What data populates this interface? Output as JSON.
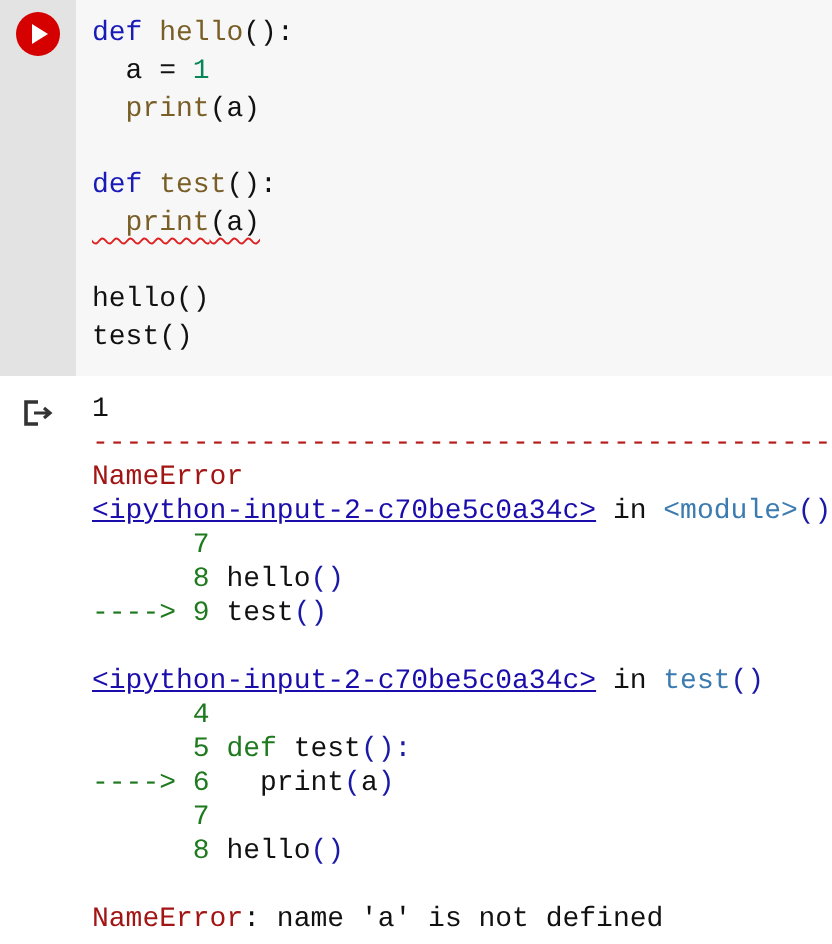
{
  "code_cell": {
    "blocks": [
      [
        {
          "tokens": [
            {
              "text": "def",
              "kind": "kw"
            },
            {
              "text": " hello",
              "kind": "fn"
            },
            {
              "text": "():",
              "kind": "plain"
            }
          ]
        },
        {
          "tokens": [
            {
              "text": "  a = ",
              "kind": "plain"
            },
            {
              "text": "1",
              "kind": "num"
            }
          ]
        },
        {
          "tokens": [
            {
              "text": "  print",
              "kind": "fn"
            },
            {
              "text": "(a)",
              "kind": "plain"
            }
          ]
        }
      ],
      [
        {
          "tokens": [
            {
              "text": "def",
              "kind": "kw"
            },
            {
              "text": " test",
              "kind": "fn"
            },
            {
              "text": "():",
              "kind": "plain"
            }
          ]
        },
        {
          "tokens": [
            {
              "text": "  print",
              "kind": "fn"
            },
            {
              "text": "(a)",
              "kind": "plain"
            }
          ],
          "error": true
        }
      ],
      [
        {
          "tokens": [
            {
              "text": "hello()",
              "kind": "plain"
            }
          ]
        },
        {
          "tokens": [
            {
              "text": "test()",
              "kind": "plain"
            }
          ]
        }
      ]
    ]
  },
  "output": {
    "blocks": [
      [
        {
          "tokens": [
            {
              "text": "1",
              "kind": "plain"
            }
          ]
        },
        {
          "tokens": [
            {
              "text": "--------------------------------------------",
              "kind": "rule"
            }
          ]
        },
        {
          "tokens": [
            {
              "text": "NameError",
              "kind": "err"
            }
          ]
        },
        {
          "tokens": [
            {
              "text": "<ipython-input-2-c70be5c0a34c>",
              "kind": "link"
            },
            {
              "text": " in ",
              "kind": "plain"
            },
            {
              "text": "<module>",
              "kind": "func"
            },
            {
              "text": "()",
              "kind": "paren"
            }
          ]
        },
        {
          "tokens": [
            {
              "text": "      7",
              "kind": "lineno"
            }
          ]
        },
        {
          "tokens": [
            {
              "text": "      8",
              "kind": "lineno"
            },
            {
              "text": " hello",
              "kind": "plain"
            },
            {
              "text": "()",
              "kind": "paren"
            }
          ]
        },
        {
          "tokens": [
            {
              "text": "----> 9",
              "kind": "lineno"
            },
            {
              "text": " test",
              "kind": "plain"
            },
            {
              "text": "()",
              "kind": "paren"
            }
          ]
        }
      ],
      [
        {
          "tokens": [
            {
              "text": "<ipython-input-2-c70be5c0a34c>",
              "kind": "link"
            },
            {
              "text": " in ",
              "kind": "plain"
            },
            {
              "text": "test",
              "kind": "func"
            },
            {
              "text": "()",
              "kind": "paren"
            }
          ]
        },
        {
          "tokens": [
            {
              "text": "      4",
              "kind": "lineno"
            }
          ]
        },
        {
          "tokens": [
            {
              "text": "      5 def",
              "kind": "lineno"
            },
            {
              "text": " test",
              "kind": "plain"
            },
            {
              "text": "():",
              "kind": "paren"
            }
          ]
        },
        {
          "tokens": [
            {
              "text": "----> 6",
              "kind": "lineno"
            },
            {
              "text": "   print",
              "kind": "plain"
            },
            {
              "text": "(",
              "kind": "paren"
            },
            {
              "text": "a",
              "kind": "plain"
            },
            {
              "text": ")",
              "kind": "paren"
            }
          ]
        },
        {
          "tokens": [
            {
              "text": "      7",
              "kind": "lineno"
            }
          ]
        },
        {
          "tokens": [
            {
              "text": "      8",
              "kind": "lineno"
            },
            {
              "text": " hello",
              "kind": "plain"
            },
            {
              "text": "()",
              "kind": "paren"
            }
          ]
        }
      ],
      [
        {
          "tokens": [
            {
              "text": "NameError",
              "kind": "err"
            },
            {
              "text": ": name 'a' is not defined",
              "kind": "plain"
            }
          ]
        }
      ]
    ]
  }
}
